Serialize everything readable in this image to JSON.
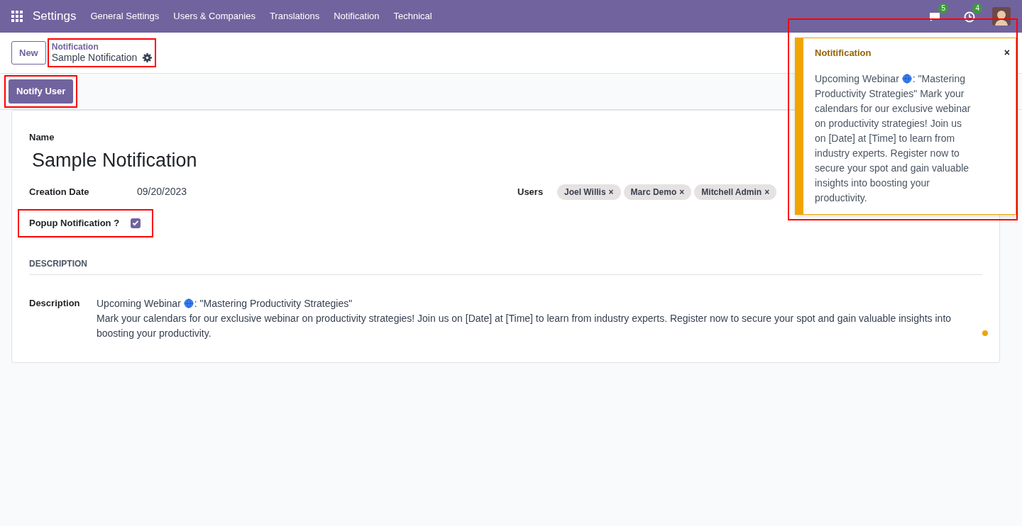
{
  "navbar": {
    "app": "Settings",
    "menu": [
      "General Settings",
      "Users & Companies",
      "Translations",
      "Notification",
      "Technical"
    ],
    "messages_count": "5",
    "activities_count": "4"
  },
  "control_panel": {
    "new_button": "New",
    "breadcrumb": {
      "parent": "Notification",
      "current": "Sample Notification",
      "highlighted": true
    }
  },
  "status_bar": {
    "button": "Notify User",
    "highlighted": true
  },
  "form": {
    "name_label": "Name",
    "name": "Sample Notification",
    "creation_date_label": "Creation Date",
    "creation_date": "09/20/2023",
    "popup_label": "Popup Notification ?",
    "popup_checked": true,
    "popup_highlighted": true,
    "users_label": "Users",
    "users": [
      {
        "name": "Joel Willis",
        "remove": "×"
      },
      {
        "name": "Marc Demo",
        "remove": "×"
      },
      {
        "name": "Mitchell Admin",
        "remove": "×"
      }
    ],
    "section_title": "DESCRIPTION",
    "description_label": "Description",
    "description_title_before": "Upcoming Webinar",
    "description_title_after": ": \"Mastering Productivity Strategies\"",
    "description_body": "Mark your calendars for our exclusive webinar on productivity strategies! Join us on [Date] at [Time] to learn from industry experts. Register now to secure your spot and gain valuable insights into boosting your productivity."
  },
  "toast": {
    "title": "Notitification",
    "message_before": "Upcoming Webinar",
    "message_mid": ": \"Mastering",
    "message_after": "Productivity Strategies\" Mark your calendars for our exclusive webinar on productivity strategies! Join us on [Date] at [Time] to learn from industry experts. Register now to secure your spot and gain valuable insights into boosting your productivity.",
    "close": "×",
    "highlighted": true
  }
}
